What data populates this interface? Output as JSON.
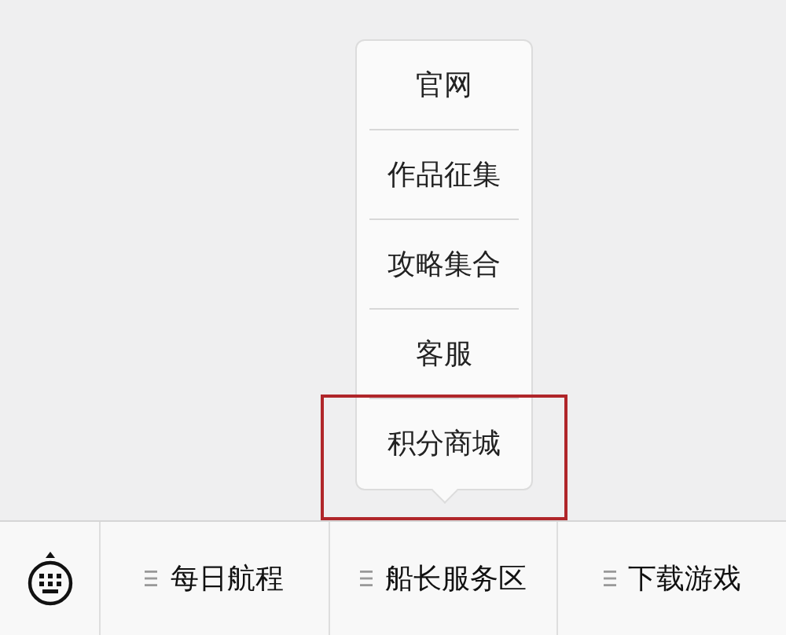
{
  "popup_menu": {
    "items": [
      {
        "label": "官网",
        "highlighted": false
      },
      {
        "label": "作品征集",
        "highlighted": false
      },
      {
        "label": "攻略集合",
        "highlighted": false
      },
      {
        "label": "客服",
        "highlighted": false
      },
      {
        "label": "积分商城",
        "highlighted": true
      }
    ]
  },
  "bottom_bar": {
    "menus": [
      {
        "label": "每日航程"
      },
      {
        "label": "船长服务区"
      },
      {
        "label": "下载游戏"
      }
    ]
  }
}
